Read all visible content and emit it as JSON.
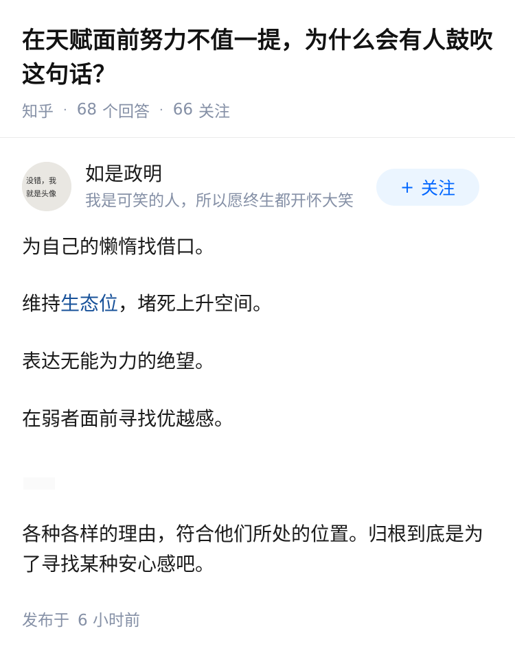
{
  "question": {
    "title": "在天赋面前努力不值一提，为什么会有人鼓吹这句话？",
    "source": "知乎",
    "answer_count": "68",
    "answer_label": "个回答",
    "follower_count": "66",
    "follower_label": "关注"
  },
  "author": {
    "name": "如是政明",
    "bio": "我是可笑的人，所以愿终生都开怀大笑",
    "avatar_text_line1": "没错，我",
    "avatar_text_line2": "就是头像",
    "follow_plus": "+",
    "follow_label": "关注"
  },
  "answer": {
    "p1": "为自己的懒惰找借口。",
    "p2_before": "维持",
    "p2_link": "生态位",
    "p2_after": "，堵死上升空间。",
    "p3": "表达无能为力的绝望。",
    "p4": "在弱者面前寻找优越感。",
    "p5": "各种各样的理由，符合他们所处的位置。归根到底是为了寻找某种安心感吧。"
  },
  "footer": {
    "published_label": "发布于",
    "published_time": "6 小时前"
  },
  "colors": {
    "link": "#175199",
    "meta": "#8590a6",
    "follow_bg": "#ebf5ff",
    "follow_text": "#0066ff"
  }
}
